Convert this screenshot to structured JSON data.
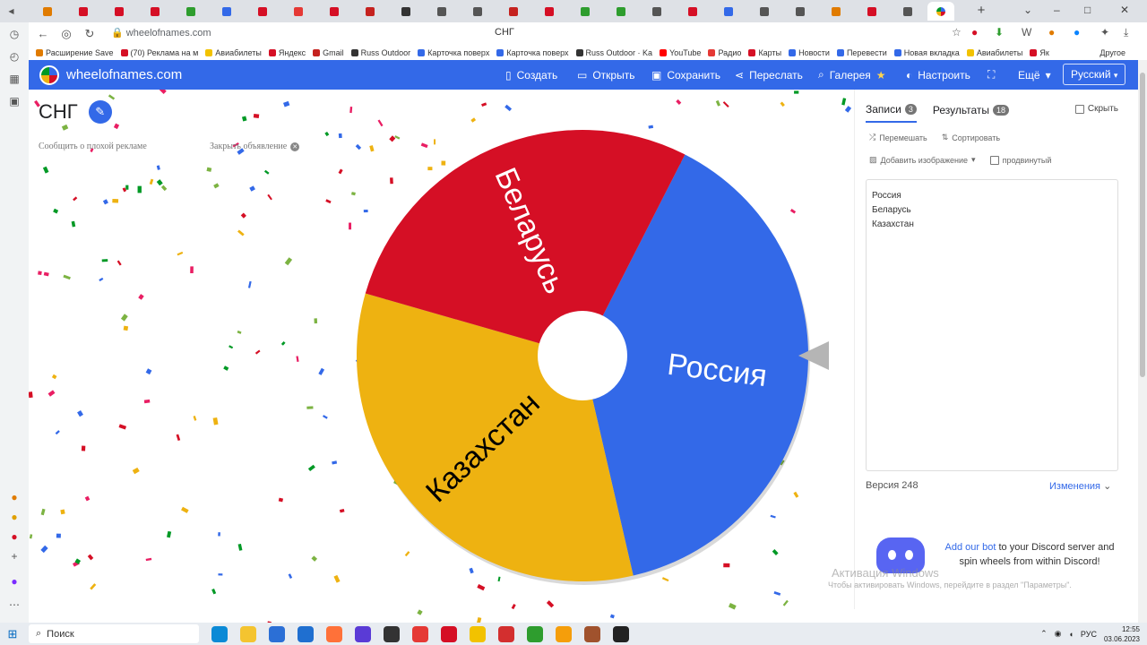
{
  "browser": {
    "tabs_count": 33,
    "active_tab_icon": "wheel-favicon",
    "url": "wheelofnames.com",
    "page_title": "СНГ",
    "bookmarks": [
      "Расширение Save",
      "(70) Реклама на м",
      "Авиабилеты",
      "Яндекс",
      "Gmail",
      "Russ Outdoor",
      "Карточка поверх",
      "Карточка поверх",
      "Russ Outdoor · Ka",
      "YouTube",
      "Радио",
      "Карты",
      "Новости",
      "Перевести",
      "Новая вкладка",
      "Авиабилеты",
      "Як"
    ],
    "bookmarks_other": "Другое"
  },
  "app": {
    "brand": "wheelofnames.com",
    "menu": {
      "create": "Создать",
      "open": "Открыть",
      "save": "Сохранить",
      "share": "Переслать",
      "gallery": "Галерея",
      "settings": "Настроить",
      "more": "Ещё",
      "language": "Русский"
    }
  },
  "main": {
    "wheel_title": "СНГ",
    "report_ad": "Сообщить о плохой рекламе",
    "close_ad": "Закрыть объявление"
  },
  "wheel": {
    "segments": [
      {
        "label": "Россия",
        "color": "#3369e8"
      },
      {
        "label": "Казахстан",
        "color": "#eeb211"
      },
      {
        "label": "Беларусь",
        "color": "#d50f25"
      }
    ]
  },
  "panel": {
    "tab_entries": "Записи",
    "entries_count": "3",
    "tab_results": "Результаты",
    "results_count": "18",
    "hide": "Скрыть",
    "shuffle": "Перемешать",
    "sort": "Сортировать",
    "add_image": "Добавить изображение",
    "advanced": "продвинутый",
    "entries": [
      "Россия",
      "Беларусь",
      "Казахстан"
    ],
    "version": "Версия 248",
    "changes": "Изменения",
    "discord_link": "Add our bot",
    "discord_text": "to your Discord server and spin wheels from within Discord!"
  },
  "windows": {
    "watermark_title": "Активация Windows",
    "watermark_text": "Чтобы активировать Windows, перейдите в раздел \"Параметры\".",
    "search": "Поиск",
    "lang": "РУС",
    "time": "12:55",
    "date": "03.06.2023"
  },
  "colors": {
    "brand_blue": "#3369e8",
    "red": "#d50f25",
    "yellow": "#eeb211",
    "green": "#009925"
  }
}
